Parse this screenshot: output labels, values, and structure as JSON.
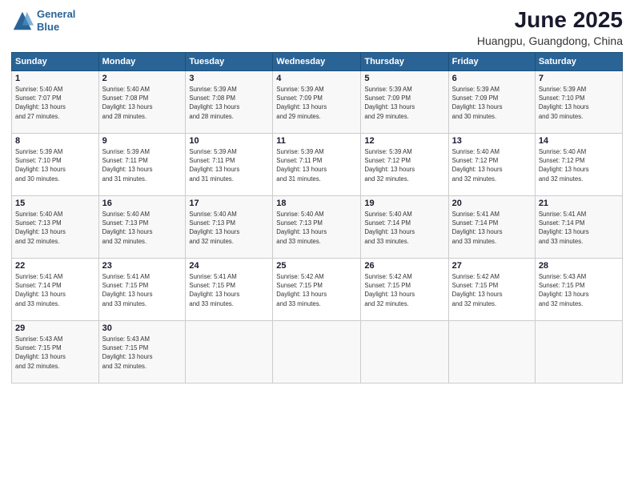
{
  "logo": {
    "line1": "General",
    "line2": "Blue"
  },
  "title": "June 2025",
  "subtitle": "Huangpu, Guangdong, China",
  "weekdays": [
    "Sunday",
    "Monday",
    "Tuesday",
    "Wednesday",
    "Thursday",
    "Friday",
    "Saturday"
  ],
  "weeks": [
    [
      {
        "day": "1",
        "rise": "5:40 AM",
        "set": "7:07 PM",
        "hours": "13 hours and 27 minutes."
      },
      {
        "day": "2",
        "rise": "5:40 AM",
        "set": "7:08 PM",
        "hours": "13 hours and 28 minutes."
      },
      {
        "day": "3",
        "rise": "5:39 AM",
        "set": "7:08 PM",
        "hours": "13 hours and 28 minutes."
      },
      {
        "day": "4",
        "rise": "5:39 AM",
        "set": "7:09 PM",
        "hours": "13 hours and 29 minutes."
      },
      {
        "day": "5",
        "rise": "5:39 AM",
        "set": "7:09 PM",
        "hours": "13 hours and 29 minutes."
      },
      {
        "day": "6",
        "rise": "5:39 AM",
        "set": "7:09 PM",
        "hours": "13 hours and 30 minutes."
      },
      {
        "day": "7",
        "rise": "5:39 AM",
        "set": "7:10 PM",
        "hours": "13 hours and 30 minutes."
      }
    ],
    [
      {
        "day": "8",
        "rise": "5:39 AM",
        "set": "7:10 PM",
        "hours": "13 hours and 30 minutes."
      },
      {
        "day": "9",
        "rise": "5:39 AM",
        "set": "7:11 PM",
        "hours": "13 hours and 31 minutes."
      },
      {
        "day": "10",
        "rise": "5:39 AM",
        "set": "7:11 PM",
        "hours": "13 hours and 31 minutes."
      },
      {
        "day": "11",
        "rise": "5:39 AM",
        "set": "7:11 PM",
        "hours": "13 hours and 31 minutes."
      },
      {
        "day": "12",
        "rise": "5:39 AM",
        "set": "7:12 PM",
        "hours": "13 hours and 32 minutes."
      },
      {
        "day": "13",
        "rise": "5:40 AM",
        "set": "7:12 PM",
        "hours": "13 hours and 32 minutes."
      },
      {
        "day": "14",
        "rise": "5:40 AM",
        "set": "7:12 PM",
        "hours": "13 hours and 32 minutes."
      }
    ],
    [
      {
        "day": "15",
        "rise": "5:40 AM",
        "set": "7:13 PM",
        "hours": "13 hours and 32 minutes."
      },
      {
        "day": "16",
        "rise": "5:40 AM",
        "set": "7:13 PM",
        "hours": "13 hours and 32 minutes."
      },
      {
        "day": "17",
        "rise": "5:40 AM",
        "set": "7:13 PM",
        "hours": "13 hours and 32 minutes."
      },
      {
        "day": "18",
        "rise": "5:40 AM",
        "set": "7:13 PM",
        "hours": "13 hours and 33 minutes."
      },
      {
        "day": "19",
        "rise": "5:40 AM",
        "set": "7:14 PM",
        "hours": "13 hours and 33 minutes."
      },
      {
        "day": "20",
        "rise": "5:41 AM",
        "set": "7:14 PM",
        "hours": "13 hours and 33 minutes."
      },
      {
        "day": "21",
        "rise": "5:41 AM",
        "set": "7:14 PM",
        "hours": "13 hours and 33 minutes."
      }
    ],
    [
      {
        "day": "22",
        "rise": "5:41 AM",
        "set": "7:14 PM",
        "hours": "13 hours and 33 minutes."
      },
      {
        "day": "23",
        "rise": "5:41 AM",
        "set": "7:15 PM",
        "hours": "13 hours and 33 minutes."
      },
      {
        "day": "24",
        "rise": "5:41 AM",
        "set": "7:15 PM",
        "hours": "13 hours and 33 minutes."
      },
      {
        "day": "25",
        "rise": "5:42 AM",
        "set": "7:15 PM",
        "hours": "13 hours and 33 minutes."
      },
      {
        "day": "26",
        "rise": "5:42 AM",
        "set": "7:15 PM",
        "hours": "13 hours and 32 minutes."
      },
      {
        "day": "27",
        "rise": "5:42 AM",
        "set": "7:15 PM",
        "hours": "13 hours and 32 minutes."
      },
      {
        "day": "28",
        "rise": "5:43 AM",
        "set": "7:15 PM",
        "hours": "13 hours and 32 minutes."
      }
    ],
    [
      {
        "day": "29",
        "rise": "5:43 AM",
        "set": "7:15 PM",
        "hours": "13 hours and 32 minutes."
      },
      {
        "day": "30",
        "rise": "5:43 AM",
        "set": "7:15 PM",
        "hours": "13 hours and 32 minutes."
      },
      null,
      null,
      null,
      null,
      null
    ]
  ],
  "labels": {
    "sunrise": "Sunrise:",
    "sunset": "Sunset:",
    "daylight": "Daylight: 13 hours"
  },
  "colors": {
    "header_bg": "#2a6496",
    "header_text": "#ffffff",
    "logo_blue": "#2a6496",
    "logo_dark": "#1a1a2e"
  }
}
